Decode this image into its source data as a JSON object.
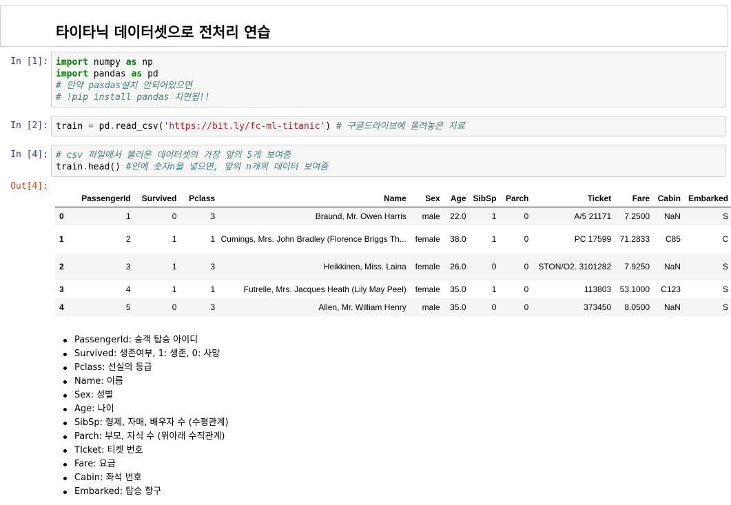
{
  "markdown": {
    "title": "타이타닉 데이터셋으로 전처리 연습"
  },
  "cells": [
    {
      "prompt": "In [1]:",
      "lines": [
        [
          {
            "t": "kw",
            "v": "import"
          },
          {
            "t": "",
            "v": " numpy "
          },
          {
            "t": "kw",
            "v": "as"
          },
          {
            "t": "",
            "v": " np"
          }
        ],
        [
          {
            "t": "kw",
            "v": "import"
          },
          {
            "t": "",
            "v": " pandas "
          },
          {
            "t": "kw",
            "v": "as"
          },
          {
            "t": "",
            "v": " pd"
          }
        ],
        [
          {
            "t": "cm",
            "v": "# 만약 pasdas설치 안되어있으면"
          }
        ],
        [
          {
            "t": "cm",
            "v": "# !pip install pandas 치면됨!!"
          }
        ]
      ]
    },
    {
      "prompt": "In [2]:",
      "lines": [
        [
          {
            "t": "",
            "v": "train "
          },
          {
            "t": "op",
            "v": "="
          },
          {
            "t": "",
            "v": " pd"
          },
          {
            "t": "op",
            "v": "."
          },
          {
            "t": "",
            "v": "read_csv("
          },
          {
            "t": "str",
            "v": "'https://bit.ly/fc-ml-titanic'"
          },
          {
            "t": "",
            "v": ") "
          },
          {
            "t": "cm",
            "v": "# 구글드라이브에 올려놓은 자료"
          }
        ]
      ]
    },
    {
      "prompt": "In [4]:",
      "lines": [
        [
          {
            "t": "cm",
            "v": "# csv 파일에서 불러온 데이터셋의 가장 앞의 5개 보여줌"
          }
        ],
        [
          {
            "t": "",
            "v": "train"
          },
          {
            "t": "op",
            "v": "."
          },
          {
            "t": "",
            "v": "head() "
          },
          {
            "t": "cm",
            "v": "#안에 숫자n을 넣으면, 앞의 n개의 데이터 보여줌"
          }
        ]
      ]
    }
  ],
  "output": {
    "prompt": "Out[4]:",
    "columns": [
      "",
      "PassengerId",
      "Survived",
      "Pclass",
      "Name",
      "Sex",
      "Age",
      "SibSp",
      "Parch",
      "Ticket",
      "Fare",
      "Cabin",
      "Embarked"
    ],
    "rows": [
      [
        "0",
        "1",
        "0",
        "3",
        "Braund, Mr. Owen Harris",
        "male",
        "22.0",
        "1",
        "0",
        "A/5 21171",
        "7.2500",
        "NaN",
        "S"
      ],
      [
        "1",
        "2",
        "1",
        "1",
        "Cumings, Mrs. John Bradley (Florence Briggs Th...",
        "female",
        "38.0",
        "1",
        "0",
        "PC 17599",
        "71.2833",
        "C85",
        "C"
      ],
      [
        "2",
        "3",
        "1",
        "3",
        "Heikkinen, Miss. Laina",
        "female",
        "26.0",
        "0",
        "0",
        "STON/O2. 3101282",
        "7.9250",
        "NaN",
        "S"
      ],
      [
        "3",
        "4",
        "1",
        "1",
        "Futrelle, Mrs. Jacques Heath (Lily May Peel)",
        "female",
        "35.0",
        "1",
        "0",
        "113803",
        "53.1000",
        "C123",
        "S"
      ],
      [
        "4",
        "5",
        "0",
        "3",
        "Allen, Mr. William Henry",
        "male",
        "35.0",
        "0",
        "0",
        "373450",
        "8.0500",
        "NaN",
        "S"
      ]
    ]
  },
  "descriptions": [
    "PassengerId: 승객 탑승 아이디",
    "Survived: 생존여부, 1: 생존, 0: 사망",
    "Pclass: 선실의 등급",
    "Name: 이름",
    "Sex: 성별",
    "Age: 나이",
    "SibSp: 형제, 자매, 배우자 수 (수평관계)",
    "Parch: 부모, 자식 수 (위아래 수직관계)",
    "TIcket: 티켓 번호",
    "Fare: 요금",
    "Cabin: 좌석 번호",
    "Embarked: 탑승 항구"
  ]
}
